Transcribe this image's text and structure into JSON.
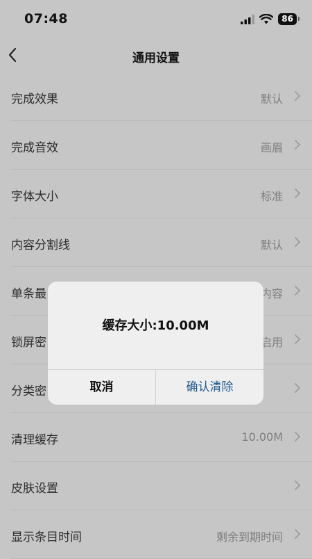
{
  "status_bar": {
    "time": "07:48",
    "battery": "86",
    "icons": [
      "signal-icon",
      "wifi-icon",
      "battery-icon"
    ]
  },
  "nav": {
    "title": "通用设置",
    "back_icon": "chevron-left-icon"
  },
  "settings": [
    {
      "label": "完成效果",
      "value": "默认"
    },
    {
      "label": "完成音效",
      "value": "画眉"
    },
    {
      "label": "字体大小",
      "value": "标准"
    },
    {
      "label": "内容分割线",
      "value": "默认"
    },
    {
      "label": "单条最",
      "value": "内容"
    },
    {
      "label": "锁屏密",
      "value": "启用"
    },
    {
      "label": "分类密",
      "value": ""
    },
    {
      "label": "清理缓存",
      "value": "10.00M"
    },
    {
      "label": "皮肤设置",
      "value": ""
    },
    {
      "label": "显示条目时间",
      "value": "剩余到期时间"
    }
  ],
  "dialog": {
    "message": "缓存大小:10.00M",
    "cancel_label": "取消",
    "confirm_label": "确认清除"
  },
  "colors": {
    "dimmed_background": "#c6c6c6",
    "dialog_background": "#efefef",
    "confirm_accent": "#1f5a8c"
  }
}
